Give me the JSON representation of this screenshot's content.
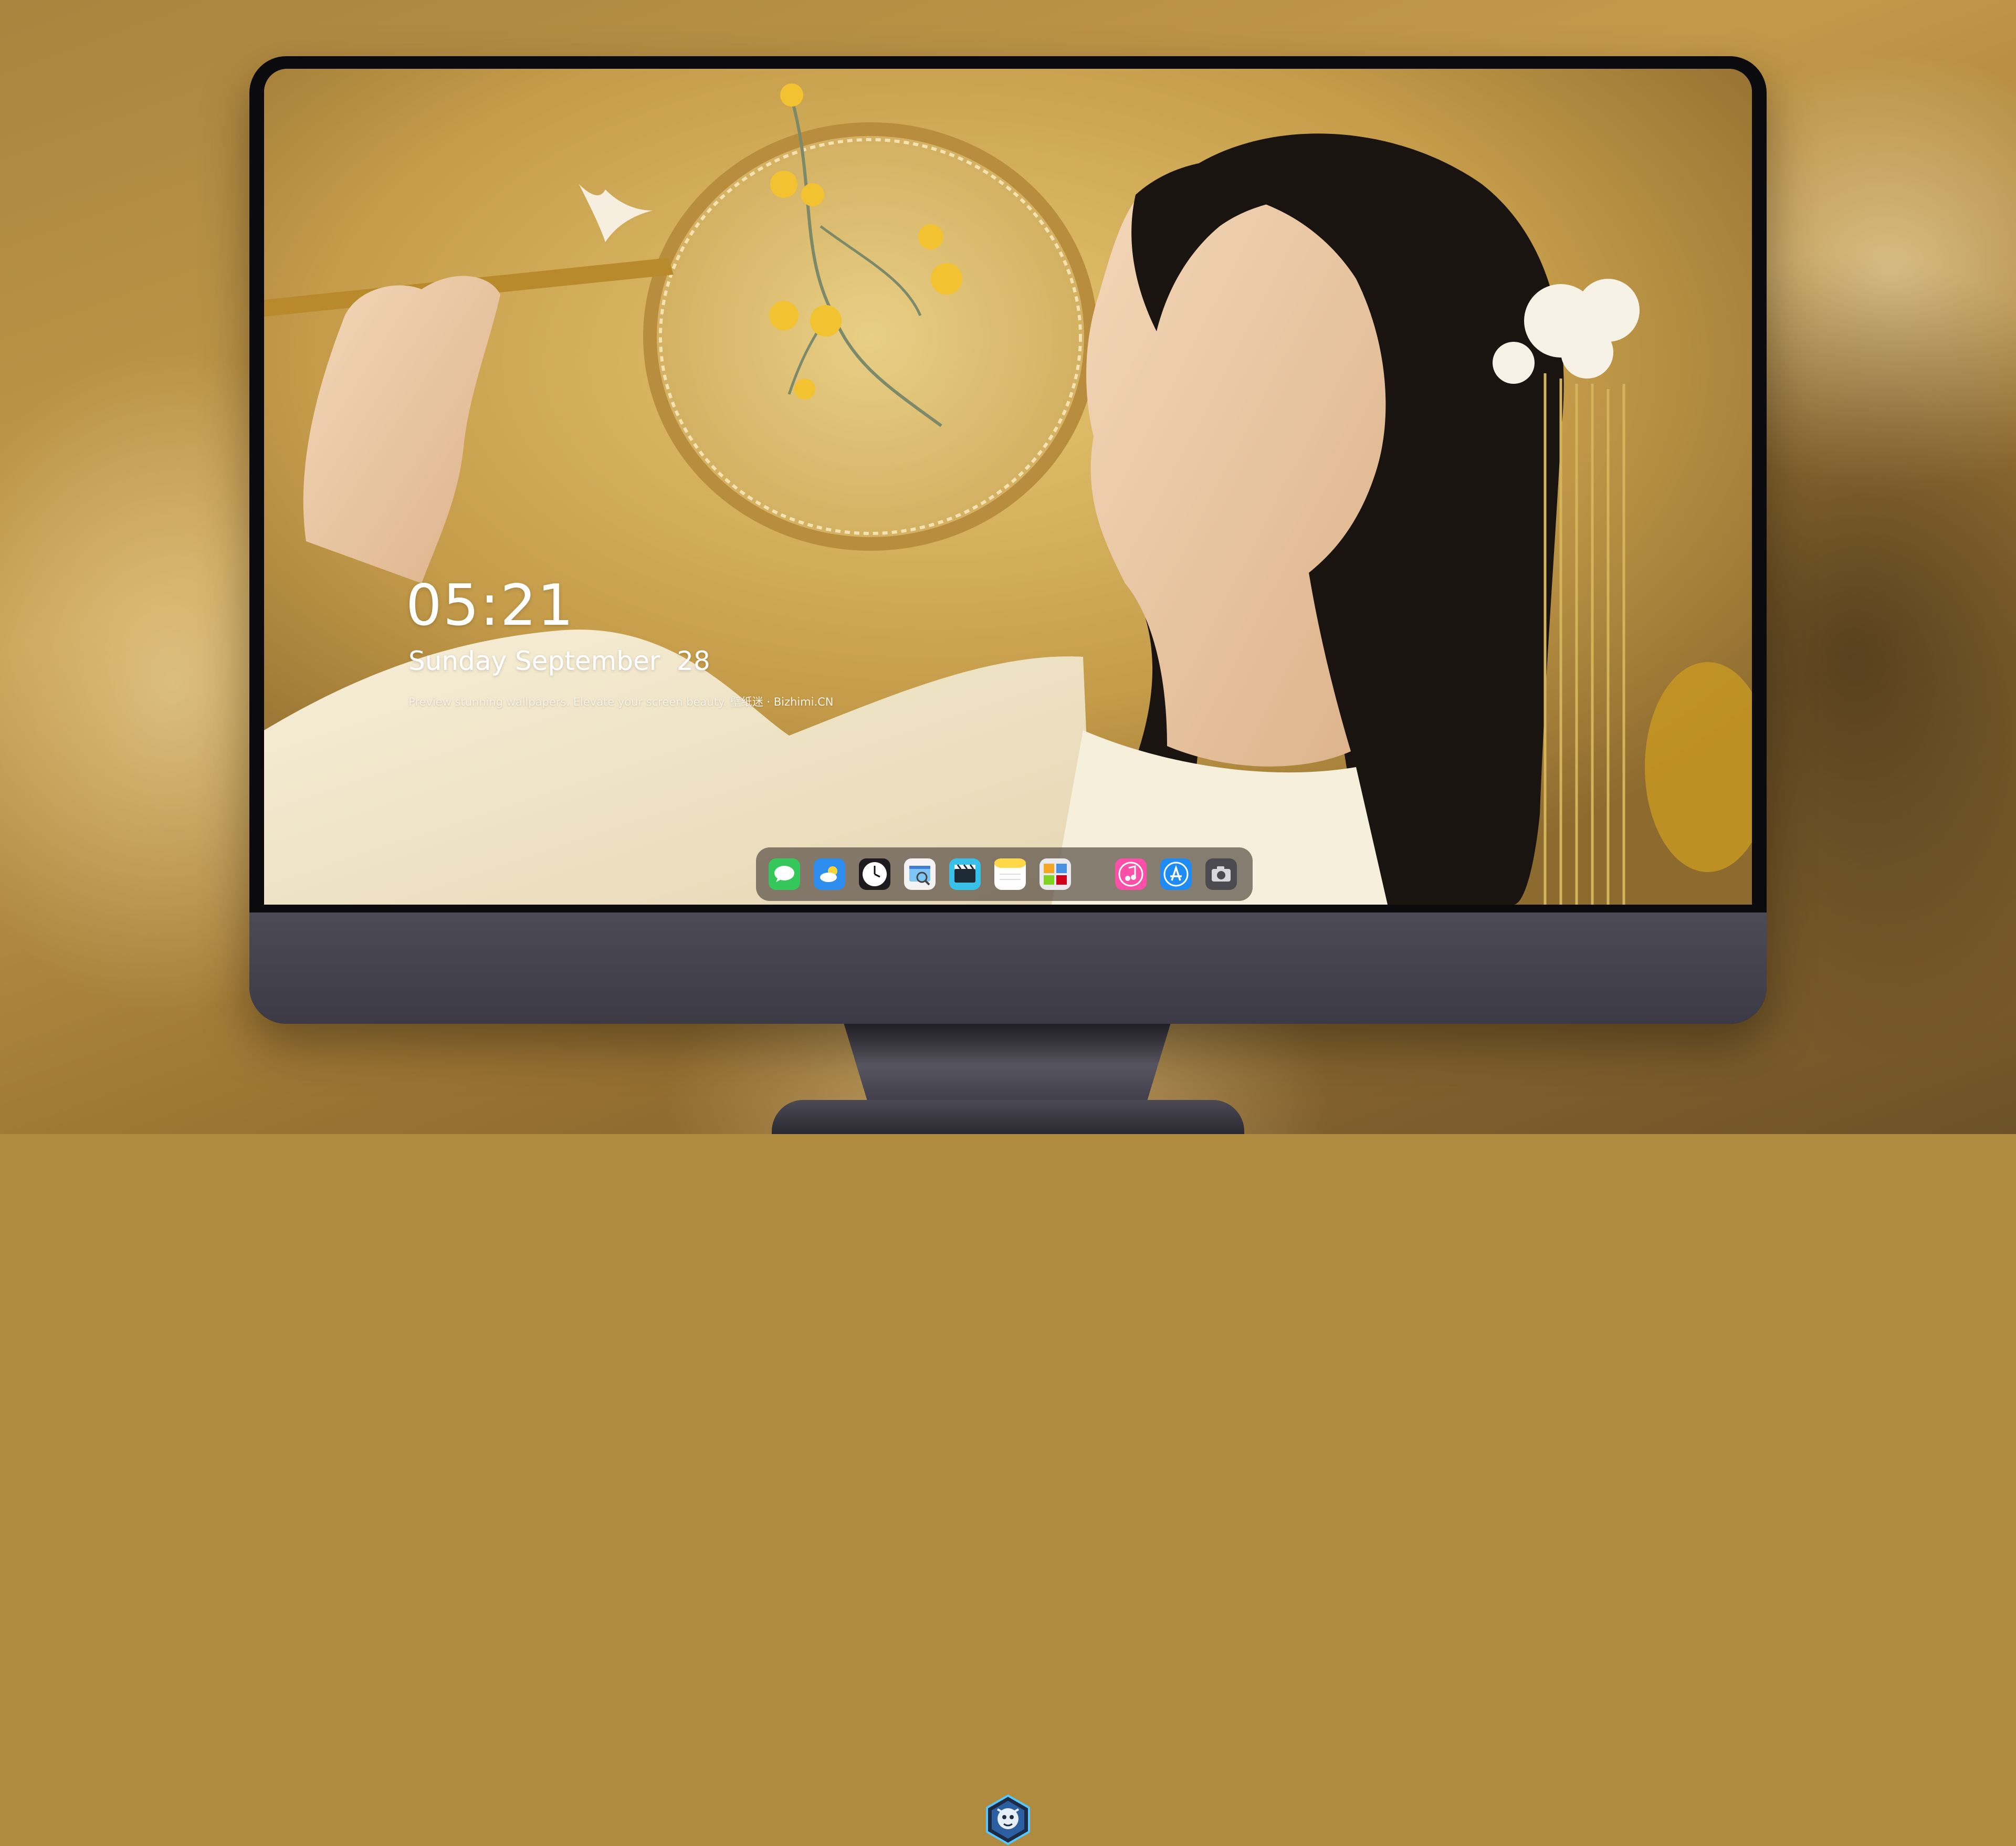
{
  "lock_screen": {
    "time": "05:21",
    "date": "Sunday September  28",
    "tagline": "Preview stunning wallpapers. Elevate your screen beauty. 壁纸迷 · Bizhimi.CN"
  },
  "dock": {
    "apps": [
      {
        "name": "Messages",
        "icon": "messages-icon",
        "color": "#35c759"
      },
      {
        "name": "Weather",
        "icon": "weather-icon",
        "color": "#2e8ef0"
      },
      {
        "name": "Clock",
        "icon": "clock-icon",
        "color": "#1c1c1e"
      },
      {
        "name": "Preview",
        "icon": "preview-icon",
        "color": "#f3f3f3"
      },
      {
        "name": "Clips",
        "icon": "clips-icon",
        "color": "#38c1e8"
      },
      {
        "name": "Notes",
        "icon": "notes-icon",
        "color": "#ffd84a"
      },
      {
        "name": "Photo Booth",
        "icon": "photo-booth-icon",
        "color": "#e9e9ee"
      },
      {
        "name": "Music",
        "icon": "music-icon",
        "color": "#fc4fa7"
      },
      {
        "name": "App Store",
        "icon": "app-store-icon",
        "color": "#1e8cf4"
      },
      {
        "name": "Camera",
        "icon": "camera-icon",
        "color": "#4a4a4f"
      }
    ]
  },
  "hardware": {
    "emblem": "dragon-emblem-icon"
  }
}
